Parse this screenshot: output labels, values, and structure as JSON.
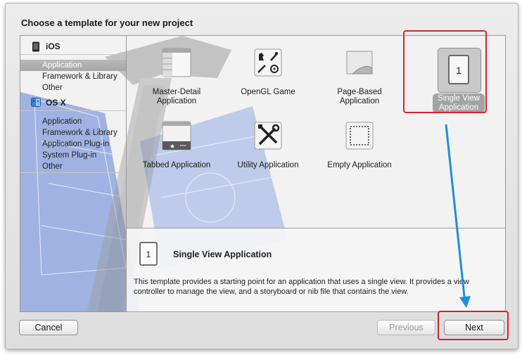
{
  "dialog": {
    "title": "Choose a template for your new project"
  },
  "sidebar": {
    "groups": [
      {
        "name": "iOS",
        "items": [
          "Application",
          "Framework & Library",
          "Other"
        ]
      },
      {
        "name": "OS X",
        "items": [
          "Application",
          "Framework & Library",
          "Application Plug-in",
          "System Plug-in",
          "Other"
        ]
      }
    ],
    "selected": "iOS / Application"
  },
  "templates": [
    {
      "label": "Master-Detail\nApplication",
      "icon": "master-detail-icon"
    },
    {
      "label": "OpenGL Game",
      "icon": "opengl-game-icon"
    },
    {
      "label": "Page-Based\nApplication",
      "icon": "page-based-icon"
    },
    {
      "label": "Single View\nApplication",
      "icon": "single-view-icon",
      "selected": true
    },
    {
      "label": "Tabbed Application",
      "icon": "tabbed-icon"
    },
    {
      "label": "Utility Application",
      "icon": "utility-icon"
    },
    {
      "label": "Empty Application",
      "icon": "empty-icon"
    }
  ],
  "template_labels": {
    "master_detail_1": "Master-Detail",
    "master_detail_2": "Application",
    "opengl": "OpenGL Game",
    "page_based_1": "Page-Based",
    "page_based_2": "Application",
    "single_view_1": "Single View",
    "single_view_2": "Application",
    "tabbed": "Tabbed Application",
    "utility": "Utility Application",
    "empty": "Empty Application"
  },
  "description": {
    "icon_glyph": "1",
    "title": "Single View Application",
    "text": "This template provides a starting point for an application that uses a single view. It provides a view controller to manage the view, and a storyboard or nib file that contains the view."
  },
  "buttons": {
    "cancel": "Cancel",
    "previous": "Previous",
    "next": "Next"
  },
  "annotations": {
    "highlight_color": "#d7232c",
    "arrow_color": "#1e8fd8"
  },
  "colors": {
    "selection": "#a6a6a6",
    "window_bg": "#e6e6e6"
  }
}
